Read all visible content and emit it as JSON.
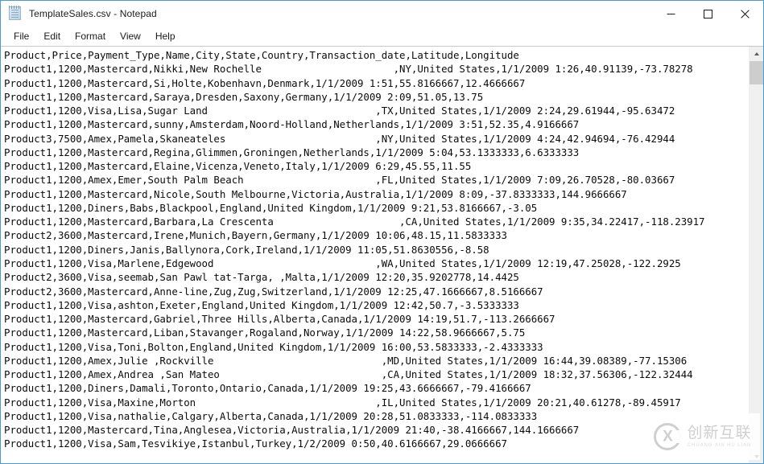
{
  "window": {
    "title": "TemplateSales.csv - Notepad",
    "icon": "notepad-icon",
    "border_color": "#4a9ad4",
    "controls": {
      "minimize_label": "Minimize",
      "maximize_label": "Maximize",
      "close_label": "Close"
    }
  },
  "menubar": {
    "items": [
      {
        "label": "File"
      },
      {
        "label": "Edit"
      },
      {
        "label": "Format"
      },
      {
        "label": "View"
      },
      {
        "label": "Help"
      }
    ]
  },
  "editor": {
    "font": "monospace",
    "text_color": "#0b0b0b",
    "background": "#ffffff",
    "content": "Product,Price,Payment_Type,Name,City,State,Country,Transaction_date,Latitude,Longitude\nProduct1,1200,Mastercard,Nikki,New Rochelle                      ,NY,United States,1/1/2009 1:26,40.91139,-73.78278\nProduct1,1200,Mastercard,Si,Holte,Kobenhavn,Denmark,1/1/2009 1:51,55.8166667,12.4666667\nProduct1,1200,Mastercard,Saraya,Dresden,Saxony,Germany,1/1/2009 2:09,51.05,13.75\nProduct1,1200,Visa,Lisa,Sugar Land                            ,TX,United States,1/1/2009 2:24,29.61944,-95.63472\nProduct1,1200,Mastercard,sunny,Amsterdam,Noord-Holland,Netherlands,1/1/2009 3:51,52.35,4.9166667\nProduct3,7500,Amex,Pamela,Skaneateles                         ,NY,United States,1/1/2009 4:24,42.94694,-76.42944\nProduct1,1200,Mastercard,Regina,Glimmen,Groningen,Netherlands,1/1/2009 5:04,53.1333333,6.6333333\nProduct1,1200,Mastercard,Elaine,Vicenza,Veneto,Italy,1/1/2009 6:29,45.55,11.55\nProduct1,1200,Amex,Emer,South Palm Beach                      ,FL,United States,1/1/2009 7:09,26.70528,-80.03667\nProduct1,1200,Mastercard,Nicole,South Melbourne,Victoria,Australia,1/1/2009 8:09,-37.8333333,144.9666667\nProduct1,1200,Diners,Babs,Blackpool,England,United Kingdom,1/1/2009 9:21,53.8166667,-3.05\nProduct1,1200,Mastercard,Barbara,La Crescenta                     ,CA,United States,1/1/2009 9:35,34.22417,-118.23917\nProduct2,3600,Mastercard,Irene,Munich,Bayern,Germany,1/1/2009 10:06,48.15,11.5833333\nProduct1,1200,Diners,Janis,Ballynora,Cork,Ireland,1/1/2009 11:05,51.8630556,-8.58\nProduct1,1200,Visa,Marlene,Edgewood                           ,WA,United States,1/1/2009 12:19,47.25028,-122.2925\nProduct2,3600,Visa,seemab,San Pawl tat-Targa, ,Malta,1/1/2009 12:20,35.9202778,14.4425\nProduct2,3600,Mastercard,Anne-line,Zug,Zug,Switzerland,1/1/2009 12:25,47.1666667,8.5166667\nProduct1,1200,Visa,ashton,Exeter,England,United Kingdom,1/1/2009 12:42,50.7,-3.5333333\nProduct1,1200,Mastercard,Gabriel,Three Hills,Alberta,Canada,1/1/2009 14:19,51.7,-113.2666667\nProduct1,1200,Mastercard,Liban,Stavanger,Rogaland,Norway,1/1/2009 14:22,58.9666667,5.75\nProduct1,1200,Visa,Toni,Bolton,England,United Kingdom,1/1/2009 16:00,53.5833333,-2.4333333\nProduct1,1200,Amex,Julie ,Rockville                            ,MD,United States,1/1/2009 16:44,39.08389,-77.15306\nProduct1,1200,Amex,Andrea ,San Mateo                           ,CA,United States,1/1/2009 18:32,37.56306,-122.32444\nProduct1,1200,Diners,Damali,Toronto,Ontario,Canada,1/1/2009 19:25,43.6666667,-79.4166667\nProduct1,1200,Visa,Maxine,Morton                              ,IL,United States,1/1/2009 20:21,40.61278,-89.45917\nProduct1,1200,Visa,nathalie,Calgary,Alberta,Canada,1/1/2009 20:28,51.0833333,-114.0833333\nProduct1,1200,Mastercard,Tina,Anglesea,Victoria,Australia,1/1/2009 21:40,-38.4166667,144.1666667\nProduct1,1200,Visa,Sam,Tesvikiye,Istanbul,Turkey,1/2/2009 0:50,40.6166667,29.0666667"
  },
  "scrollbar": {
    "up_icon": "chevron-up-icon",
    "down_icon": "chevron-down-icon",
    "thumb_color": "#cdcdcd",
    "track_color": "#f0f0f0"
  },
  "watermark": {
    "chinese": "创新互联",
    "pinyin": "CHUANG XIN HU LIAN",
    "mark_letter": "X"
  }
}
